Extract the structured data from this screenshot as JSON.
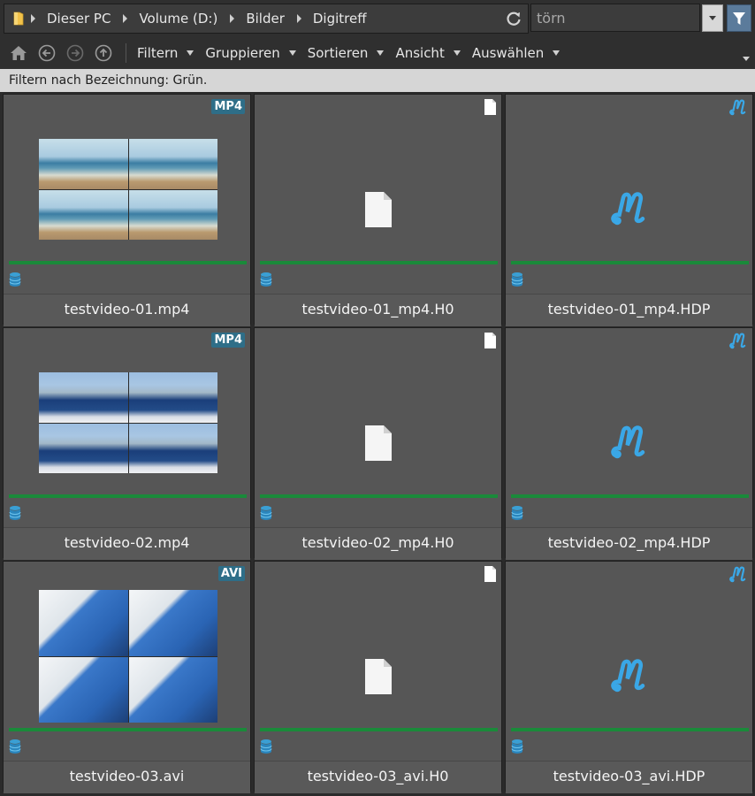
{
  "address": {
    "crumbs": [
      "Dieser PC",
      "Volume (D:)",
      "Bilder",
      "Digitreff"
    ]
  },
  "search": {
    "value": "törn"
  },
  "toolbar": {
    "menus": [
      "Filtern",
      "Gruppieren",
      "Sortieren",
      "Ansicht",
      "Auswählen"
    ]
  },
  "filterbar": {
    "text": "Filtern nach Bezeichnung: Grün."
  },
  "colors": {
    "label_green": "#1a8a3a",
    "badge": "#2e6e88"
  },
  "files": [
    {
      "name": "testvideo-01.mp4",
      "badge": "MP4",
      "type": "video",
      "thumb": "beach"
    },
    {
      "name": "testvideo-01_mp4.H0",
      "type": "file"
    },
    {
      "name": "testvideo-01_mp4.HDP",
      "type": "hdp"
    },
    {
      "name": "testvideo-02.mp4",
      "badge": "MP4",
      "type": "video",
      "thumb": "sail"
    },
    {
      "name": "testvideo-02_mp4.H0",
      "type": "file"
    },
    {
      "name": "testvideo-02_mp4.HDP",
      "type": "hdp"
    },
    {
      "name": "testvideo-03.avi",
      "badge": "AVI",
      "type": "video",
      "thumb": "sail2"
    },
    {
      "name": "testvideo-03_avi.H0",
      "type": "file"
    },
    {
      "name": "testvideo-03_avi.HDP",
      "type": "hdp"
    }
  ]
}
